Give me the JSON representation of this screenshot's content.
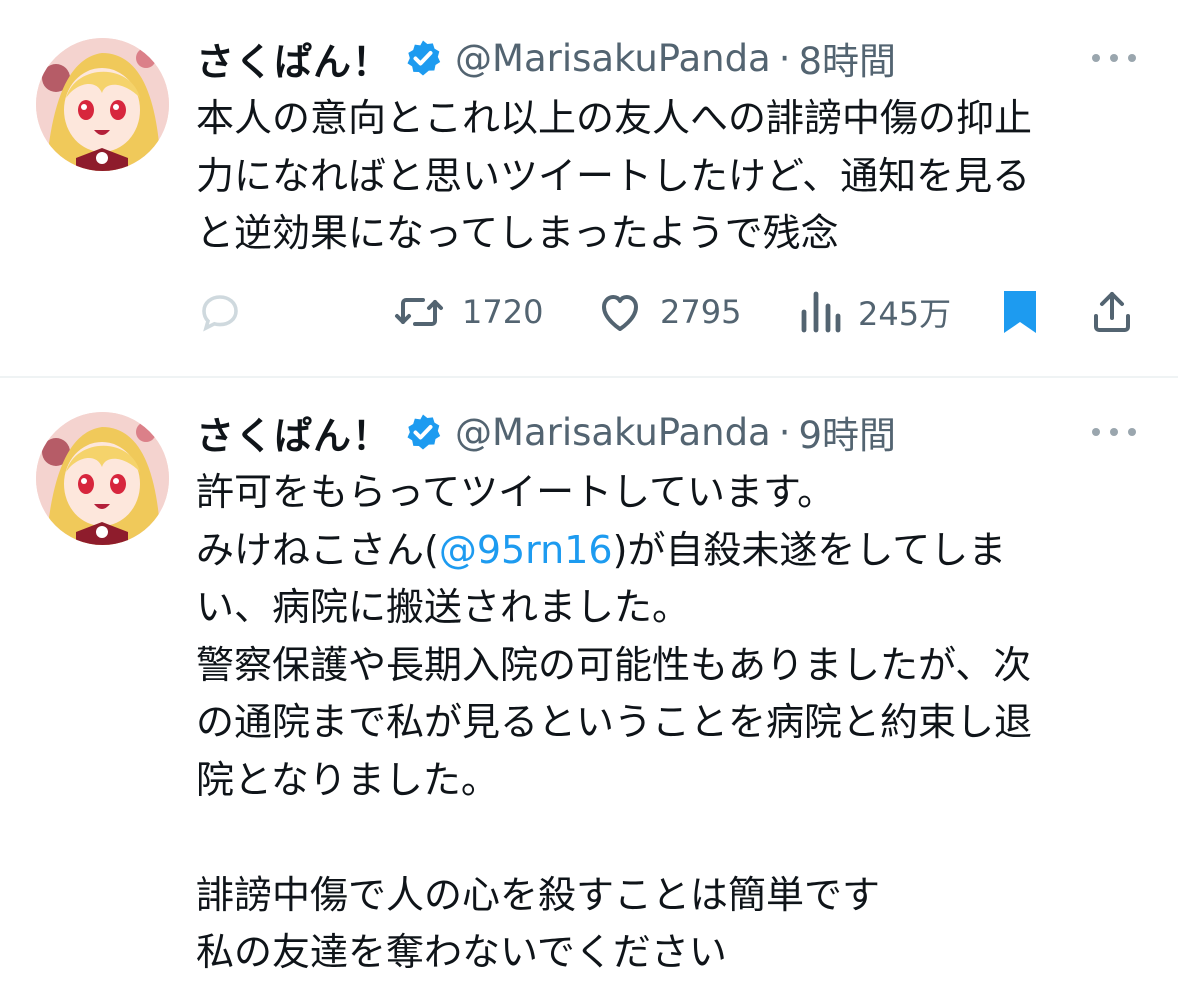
{
  "tweets": [
    {
      "display_name": "さくぱん！",
      "handle": "@MarisakuPanda",
      "separator": "·",
      "time": "8時間",
      "lines": [
        "本人の意向とこれ以上の友人への誹謗中傷の抑止",
        "力になればと思いツイートしたけど、通知を見る",
        "と逆効果になってしまったようで残念"
      ],
      "retweets": "1720",
      "likes": "2795",
      "views": "245万",
      "bookmarked": true
    },
    {
      "display_name": "さくぱん！",
      "handle": "@MarisakuPanda",
      "separator": "·",
      "time": "9時間",
      "line1": "許可をもらってツイートしています。",
      "line2_before": "みけねこさん(",
      "line2_mention": "@95rn16",
      "line2_after": ")が自殺未遂をしてしま",
      "line3": "い、病院に搬送されました。",
      "line4": "警察保護や長期入院の可能性もありましたが、次",
      "line5": "の通院まで私が見るということを病院と約束し退",
      "line6": "院となりました。",
      "line7": "",
      "line8": "誹謗中傷で人の心を殺すことは簡単です",
      "line9": "私の友達を奪わないでください"
    }
  ],
  "icons": {
    "verified": "verified-badge-icon",
    "more": "more-dots-icon",
    "reply": "reply-icon",
    "retweet": "retweet-icon",
    "like": "heart-icon",
    "views": "views-bars-icon",
    "bookmark": "bookmark-icon",
    "share": "share-icon"
  },
  "colors": {
    "accent": "#1d9bf0",
    "text": "#0f1419",
    "secondary": "#536471",
    "divider": "#eff3f4"
  }
}
